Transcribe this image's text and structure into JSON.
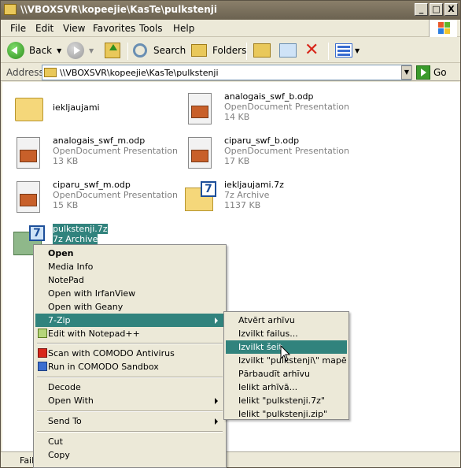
{
  "window": {
    "title": "\\\\VBOXSVR\\kopeejie\\KasTe\\pulkstenji",
    "minimize": "_",
    "maximize": "□",
    "close": "X"
  },
  "menubar": [
    "File",
    "Edit",
    "View",
    "Favorites",
    "Tools",
    "Help"
  ],
  "toolbar": {
    "back": "Back",
    "search": "Search",
    "folders": "Folders"
  },
  "address": {
    "label": "Address",
    "value": "\\\\VBOXSVR\\kopeejie\\KasTe\\pulkstenji",
    "go": "Go"
  },
  "files": [
    {
      "name": "iekljaujami",
      "type": "",
      "size": "",
      "icon": "folder-icon"
    },
    {
      "name": "analogais_swf_b.odp",
      "type": "OpenDocument Presentation",
      "size": "14 KB",
      "icon": "odp-icon"
    },
    {
      "name": "analogais_swf_m.odp",
      "type": "OpenDocument Presentation",
      "size": "13 KB",
      "icon": "odp-icon"
    },
    {
      "name": "ciparu_swf_b.odp",
      "type": "OpenDocument Presentation",
      "size": "17 KB",
      "icon": "odp-icon"
    },
    {
      "name": "ciparu_swf_m.odp",
      "type": "OpenDocument Presentation",
      "size": "15 KB",
      "icon": "odp-icon"
    },
    {
      "name": "iekljaujami.7z",
      "type": "7z Archive",
      "size": "1137 KB",
      "icon": "7z-archive-icon"
    },
    {
      "name": "pulkstenji.7z",
      "type": "7z Archive",
      "size": "",
      "icon": "7z-archive-icon"
    }
  ],
  "context_menu": {
    "items": [
      "Open",
      "Media Info",
      "NotePad",
      "Open with IrfanView",
      "Open with Geany",
      "7-Zip",
      "Edit with Notepad++",
      "Scan with COMODO Antivirus",
      "Run in COMODO Sandbox",
      "Decode",
      "Open With",
      "Send To",
      "Cut",
      "Copy"
    ]
  },
  "submenu": {
    "items": [
      "Atvērt arhīvu",
      "Izvilkt failus...",
      "Izvilkt šeit",
      "Izvilkt \"pulkstenji\\\" mapē",
      "Pārbaudīt arhīvu",
      "Ielikt arhīvā...",
      "Ielikt \"pulkstenji.7z\"",
      "Ielikt \"pulkstenji.zip\""
    ]
  },
  "status": {
    "text": "Fail"
  },
  "colors": {
    "highlight": "#31837d",
    "titlebar": "#7a705c"
  }
}
